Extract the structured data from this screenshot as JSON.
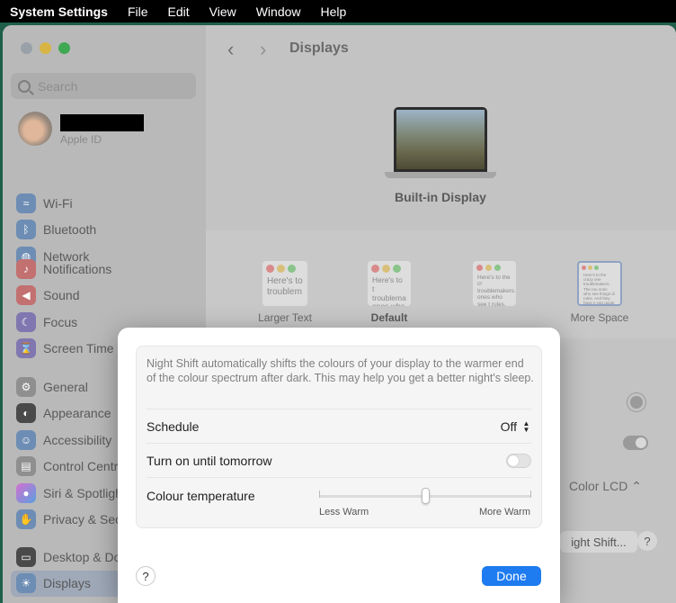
{
  "menubar": {
    "app_name": "System Settings",
    "items": [
      "File",
      "Edit",
      "View",
      "Window",
      "Help"
    ]
  },
  "sidebar": {
    "search_placeholder": "Search",
    "profile": {
      "subtitle": "Apple ID"
    },
    "groups": [
      [
        {
          "label": "Wi-Fi",
          "icon": "wifi-icon"
        },
        {
          "label": "Bluetooth",
          "icon": "bluetooth-icon"
        },
        {
          "label": "Network",
          "icon": "globe-icon"
        }
      ],
      [
        {
          "label": "Notifications",
          "icon": "bell-icon"
        },
        {
          "label": "Sound",
          "icon": "speaker-icon"
        },
        {
          "label": "Focus",
          "icon": "moon-icon"
        },
        {
          "label": "Screen Time",
          "icon": "hourglass-icon"
        }
      ],
      [
        {
          "label": "General",
          "icon": "gear-icon"
        },
        {
          "label": "Appearance",
          "icon": "appearance-icon"
        },
        {
          "label": "Accessibility",
          "icon": "accessibility-icon"
        },
        {
          "label": "Control Centre",
          "icon": "control-centre-icon"
        },
        {
          "label": "Siri & Spotlight",
          "icon": "siri-icon"
        },
        {
          "label": "Privacy & Security",
          "icon": "hand-icon"
        }
      ],
      [
        {
          "label": "Desktop & Dock",
          "icon": "dock-icon"
        },
        {
          "label": "Displays",
          "icon": "sun-icon",
          "active": true
        }
      ]
    ]
  },
  "main": {
    "title": "Displays",
    "display_name": "Built-in Display",
    "resolutions": [
      {
        "label": "Larger Text",
        "sample": "Here's to troublem"
      },
      {
        "label": "Default",
        "sample": "Here's to t troublema ones who"
      },
      {
        "label": "",
        "sample": "Here's to the cr troublemakers. ones who see t rules. And they"
      },
      {
        "label": "More Space",
        "sample": "Here's to the crazy one troublemakers. The rou ones who see things di rules. And they have n can quote them, disagr about the only thing yo Because they change th"
      }
    ],
    "color_profile": "Color LCD",
    "night_shift_button": "ight Shift...",
    "help": "?"
  },
  "modal": {
    "description": "Night Shift automatically shifts the colours of your display to the warmer end of the colour spectrum after dark. This may help you get a better night's sleep.",
    "schedule_label": "Schedule",
    "schedule_value": "Off",
    "turn_on_label": "Turn on until tomorrow",
    "turn_on_enabled": false,
    "temperature_label": "Colour temperature",
    "temperature_min_label": "Less Warm",
    "temperature_max_label": "More Warm",
    "temperature_value": 0.5,
    "help": "?",
    "done": "Done"
  }
}
